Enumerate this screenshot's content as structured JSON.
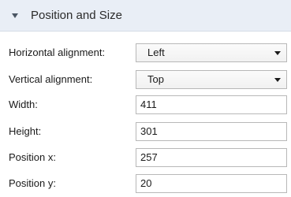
{
  "section": {
    "title": "Position and Size"
  },
  "fields": {
    "horizontal_alignment": {
      "label": "Horizontal alignment:",
      "value": "Left"
    },
    "vertical_alignment": {
      "label": "Vertical alignment:",
      "value": "Top"
    },
    "width": {
      "label": "Width:",
      "value": "411"
    },
    "height": {
      "label": "Height:",
      "value": "301"
    },
    "position_x": {
      "label": "Position x:",
      "value": "257"
    },
    "position_y": {
      "label": "Position y:",
      "value": "20"
    }
  }
}
